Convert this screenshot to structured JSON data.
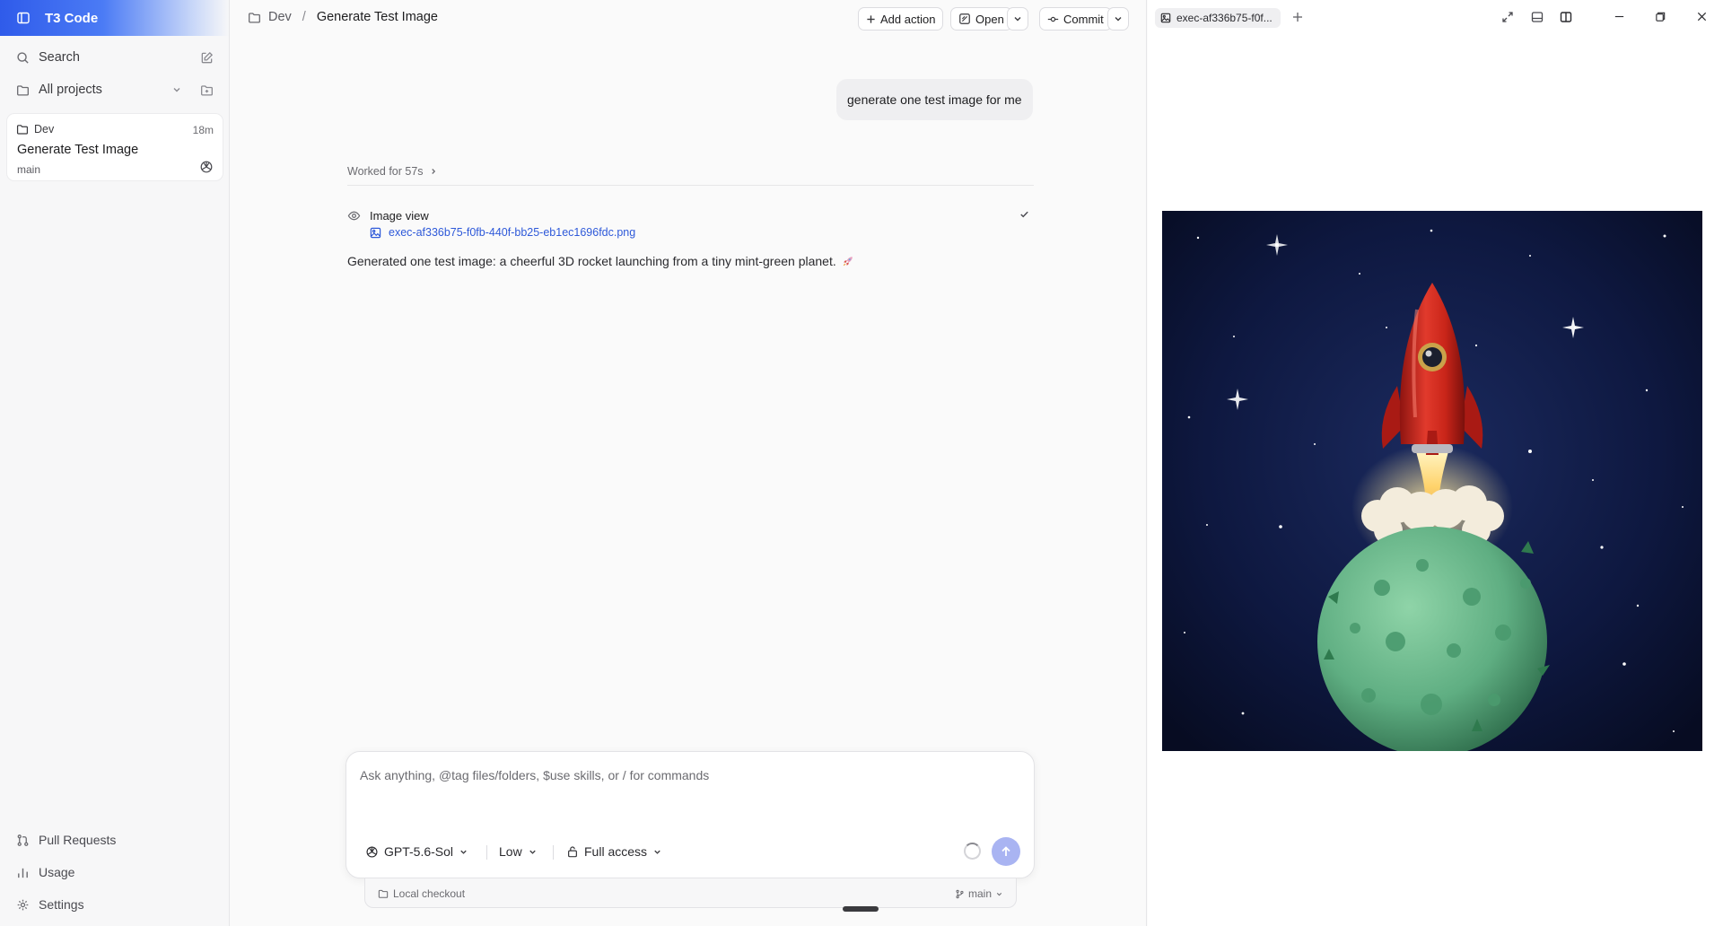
{
  "app": {
    "title": "T3 Code"
  },
  "sidebar": {
    "search_label": "Search",
    "projects_label": "All projects",
    "thread": {
      "project": "Dev",
      "time": "18m",
      "title": "Generate Test Image",
      "branch": "main"
    },
    "bottom": {
      "pull_requests": "Pull Requests",
      "usage": "Usage",
      "settings": "Settings"
    }
  },
  "header": {
    "project": "Dev",
    "separator": "/",
    "title": "Generate Test Image",
    "add_action": "Add action",
    "open": "Open",
    "commit": "Commit"
  },
  "conversation": {
    "user_message": "generate one test image for me",
    "worked_for": "Worked for 57s",
    "tool_name": "Image view",
    "file_name": "exec-af336b75-f0fb-440f-bb25-eb1ec1696fdc.png",
    "assistant_message": "Generated one test image: a cheerful 3D rocket launching from a tiny mint-green planet."
  },
  "composer": {
    "placeholder": "Ask anything, @tag files/folders, $use skills, or / for commands",
    "model": "GPT-5.6-Sol",
    "effort": "Low",
    "access": "Full access",
    "checkout": "Local checkout",
    "branch": "main"
  },
  "preview": {
    "tab_label": "exec-af336b75-f0f..."
  },
  "colors": {
    "accent": "#2f5bea",
    "link": "#2e59d9",
    "send_button": "#a9b4f2",
    "rocket_red": "#d42a22",
    "planet_green": "#5fae82",
    "space_bg": "#0b1330"
  }
}
